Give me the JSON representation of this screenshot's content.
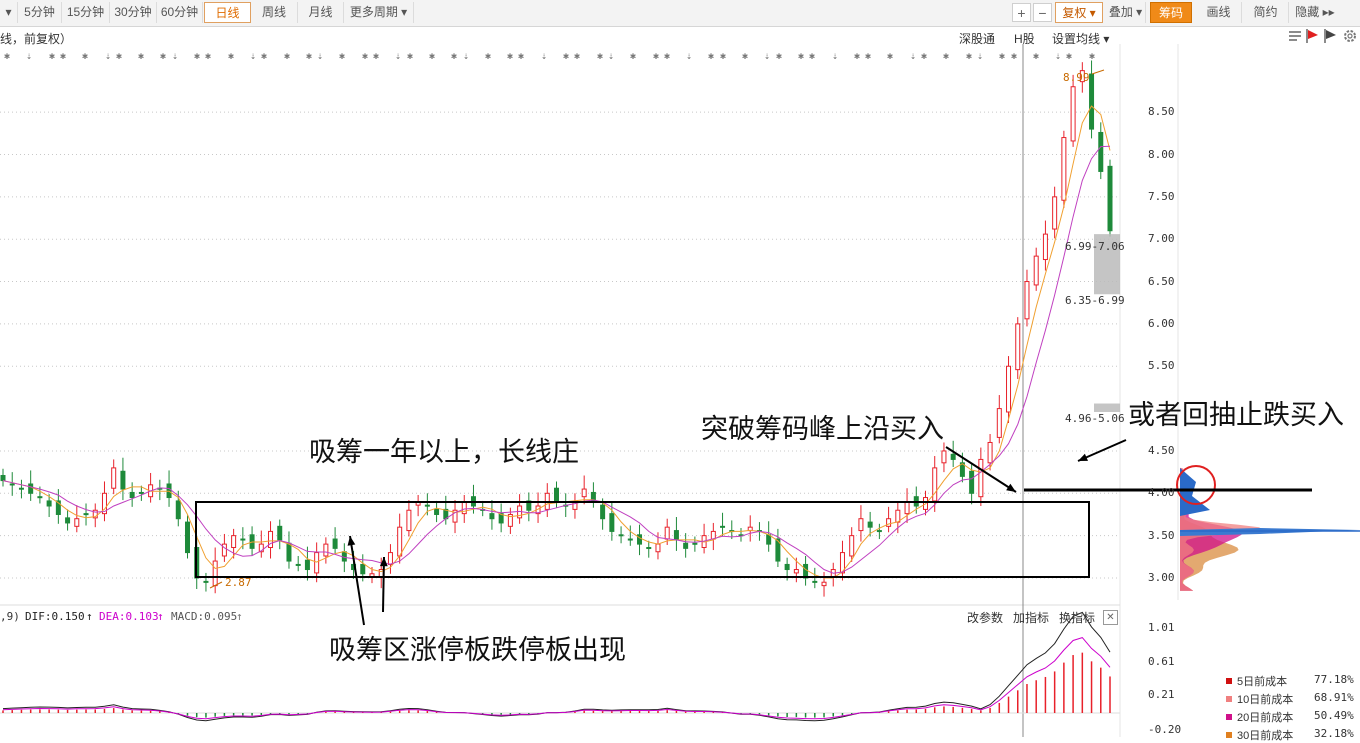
{
  "toolbar": {
    "left_glyph": "▾",
    "periods": [
      "5分钟",
      "15分钟",
      "30分钟",
      "60分钟",
      "日线",
      "周线",
      "月线",
      "更多周期 ▾"
    ],
    "active_period": "日线",
    "plus": "+",
    "minus": "−",
    "fuquan": "复权 ▾",
    "overlay": "叠加 ▾",
    "chips": "筹码",
    "huixian": "画线",
    "jianyue": "简约",
    "hide": "隐藏 ▸▸"
  },
  "chart_header": {
    "title": "线，前复权）",
    "shen_tong": "深股通",
    "h_gu": "H股",
    "ma_settings": "设置均线 ▾"
  },
  "right_icons": [
    "list-icon",
    "flag-red-icon",
    "flag-dark-icon",
    "gear-icon"
  ],
  "price_labels": {
    "high": "8.99",
    "low": "2.87",
    "range1": "6.99-7.06",
    "range2": "6.35-6.99",
    "range3": "4.96-5.06"
  },
  "annotations": {
    "accumulate": "吸筹一年以上，长线庄",
    "breakout": "突破筹码峰上沿买入",
    "pullback": "或者回抽止跌买入",
    "limits": "吸筹区涨停板跌停板出现"
  },
  "macd_header": {
    "params": ",9)",
    "dif": "DIF:0.150",
    "dea": "DEA:0.103",
    "macd": "MACD:0.095",
    "btn_params": "改参数",
    "btn_add": "加指标",
    "btn_switch": "换指标",
    "close": "✕"
  },
  "chip_legend": [
    {
      "label": "5日前成本",
      "pct": "77.18%",
      "color": "#d01010"
    },
    {
      "label": "10日前成本",
      "pct": "68.91%",
      "color": "#f08080"
    },
    {
      "label": "20日前成本",
      "pct": "50.49%",
      "color": "#d0108a"
    },
    {
      "label": "30日前成本",
      "pct": "32.18%",
      "color": "#e08020"
    }
  ],
  "chart_data": [
    {
      "type": "candlestick",
      "title": "线，前复权）",
      "y_ticks": [
        "8.50",
        "8.00",
        "7.50",
        "7.00",
        "6.50",
        "6.00",
        "5.50",
        "4.50",
        "4.00",
        "3.50",
        "3.00"
      ],
      "ylim": [
        2.75,
        9.2
      ],
      "grid": true,
      "high": 8.99,
      "low": 2.87,
      "price_zones": [
        [
          6.99,
          7.06
        ],
        [
          6.35,
          6.99
        ],
        [
          4.96,
          5.06
        ]
      ],
      "approx_closes": [
        4.15,
        4.1,
        4.05,
        4.0,
        3.95,
        3.85,
        3.75,
        3.65,
        3.7,
        3.75,
        3.8,
        4.0,
        4.3,
        4.05,
        3.95,
        4.0,
        4.1,
        4.05,
        3.95,
        3.7,
        3.3,
        3.0,
        2.95,
        3.2,
        3.4,
        3.5,
        3.45,
        3.35,
        3.4,
        3.55,
        3.45,
        3.2,
        3.15,
        3.1,
        3.3,
        3.4,
        3.35,
        3.2,
        3.1,
        3.05,
        3.05,
        3.1,
        3.3,
        3.6,
        3.8,
        3.9,
        3.85,
        3.75,
        3.7,
        3.8,
        3.9,
        3.85,
        3.8,
        3.7,
        3.65,
        3.75,
        3.85,
        3.8,
        3.85,
        4.0,
        3.9,
        3.85,
        3.9,
        4.05,
        3.9,
        3.7,
        3.55,
        3.5,
        3.45,
        3.4,
        3.35,
        3.4,
        3.6,
        3.45,
        3.35,
        3.4,
        3.5,
        3.55,
        3.6,
        3.55,
        3.5,
        3.6,
        3.55,
        3.4,
        3.2,
        3.1,
        3.1,
        3.0,
        2.95,
        2.95,
        3.1,
        3.3,
        3.5,
        3.7,
        3.6,
        3.55,
        3.7,
        3.8,
        3.9,
        3.85,
        3.95,
        4.3,
        4.5,
        4.4,
        4.2,
        4.0,
        4.4,
        4.6,
        5.0,
        5.5,
        6.0,
        6.5,
        6.8,
        7.06,
        7.5,
        8.2,
        8.8,
        8.99,
        8.3,
        7.8,
        7.1
      ]
    },
    {
      "type": "bar",
      "title": "MACD",
      "y_ticks": [
        "1.01",
        "0.61",
        "0.21",
        "-0.20"
      ],
      "ylim": [
        -0.2,
        1.01
      ],
      "series": [
        {
          "name": "DIF",
          "value": 0.15
        },
        {
          "name": "DEA",
          "value": 0.103
        },
        {
          "name": "MACD",
          "value": 0.095
        }
      ]
    }
  ],
  "colors": {
    "up": "#e8212a",
    "down": "#1e8a3a",
    "accent": "#f08a18",
    "dea": "#cc00cc",
    "price_label": "#c86a00"
  }
}
